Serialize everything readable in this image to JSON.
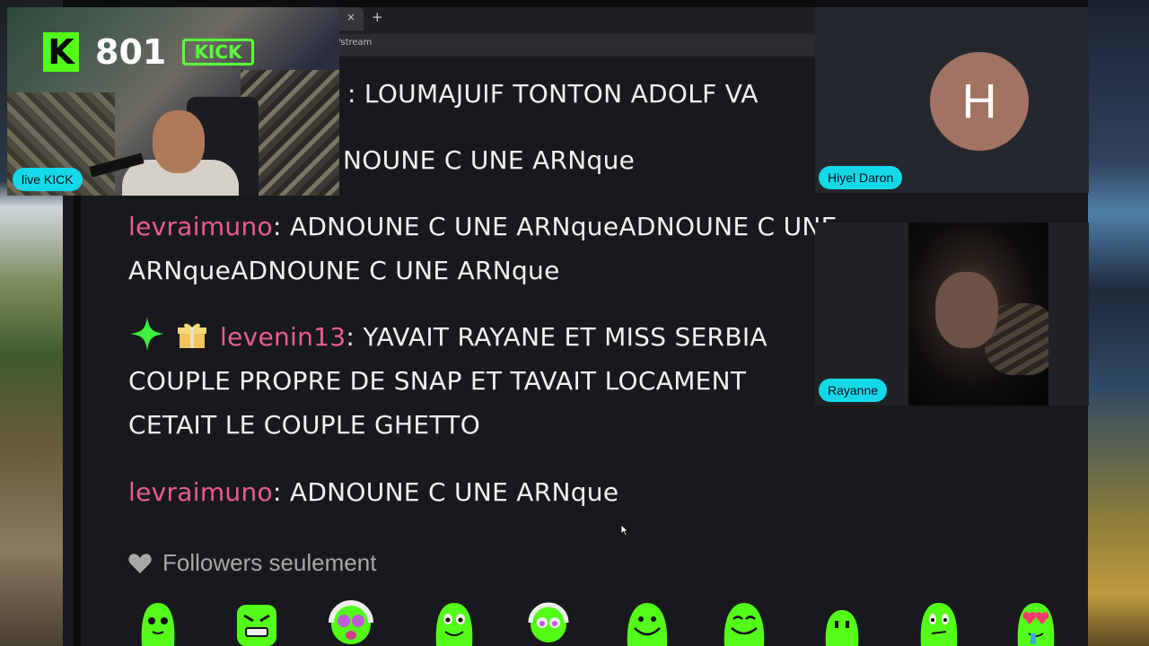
{
  "browser": {
    "url_fragment": "/stream",
    "close_glyph": "×",
    "new_tab_glyph": "+"
  },
  "stream_overlay": {
    "logo_letter": "K",
    "counter": "801",
    "neon_sign": "KICK",
    "live_label": "live KICK"
  },
  "chat": {
    "messages": [
      {
        "user": "",
        "text": ": LOUMAJUIF TONTON ADOLF VA"
      },
      {
        "user": "",
        "text": "NOUNE C UNE ARNque"
      },
      {
        "user": "levraimuno",
        "text_line1": ": ADNOUNE C UNE ARNqueADNOUNE C UNE",
        "text_line2": "ARNqueADNOUNE C UNE ARNque"
      },
      {
        "user": "levenin13",
        "text_line1": ": YAVAIT RAYANE ET MISS SERBIA",
        "text_line2": "COUPLE PROPRE DE SNAP ET TAVAIT LOCAMENT",
        "text_line3": "CETAIT LE COUPLE GHETTO"
      },
      {
        "user": "levraimuno",
        "text": ": ADNOUNE C UNE ARNque"
      }
    ],
    "followers_only_label": "Followers seulement",
    "badges": [
      "sparkle-star-icon",
      "gift-box-icon"
    ],
    "user_color": "#e85d91",
    "emote_color": "#53fc18"
  },
  "call": {
    "participant_1": {
      "name": "Hiyel Daron",
      "initial": "H",
      "avatar_color": "#a27363"
    },
    "participant_2": {
      "name": "Rayanne"
    }
  },
  "colors": {
    "kick_green": "#53fc18",
    "pill_cyan": "#15d8e8",
    "chat_bg": "#18191c"
  }
}
